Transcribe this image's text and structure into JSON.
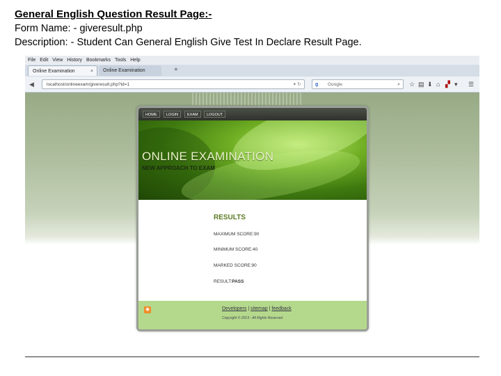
{
  "doc": {
    "title": "General English Question Result Page:-",
    "form_name": "Form Name: - giveresult.php",
    "description": "Description: - Student Can General English Give Test In Declare Result Page."
  },
  "browser": {
    "menu": [
      "File",
      "Edit",
      "View",
      "History",
      "Bookmarks",
      "Tools",
      "Help"
    ],
    "tabs": [
      {
        "label": "Online Examination",
        "close": "×"
      },
      {
        "label": "Online Examination"
      }
    ],
    "new_tab": "+",
    "url": "localhost/onlineexam/giveresult.php?id=1",
    "search_engine": "Google",
    "icons": [
      "back-icon",
      "lock-icon",
      "reload-icon",
      "search-icon",
      "star-icon",
      "bookmarks-icon",
      "download-icon",
      "home-icon",
      "menu-icon"
    ]
  },
  "site": {
    "nav": [
      "HOME",
      "LOGIN",
      "EXAM",
      "LOGOUT"
    ],
    "banner_title": "ONLINE EXAMINATION",
    "banner_subtitle": "NEW APPROACH TO EXAM",
    "results_heading": "RESULTS",
    "max_score": "MAXIMUM SCORE:90",
    "min_score": "MINIMUM SCORE:40",
    "marked_score": "MARKED SCORE:90",
    "result_label": "RESULT:",
    "result_value": "PASS",
    "footer_links": {
      "developers": "Developers",
      "sep1": " | ",
      "sitemap": "sitemap",
      "sep2": " | ",
      "feedback": "feedback"
    },
    "copyright": "Copyright © 2013 - All Rights Reserved"
  },
  "colors": {
    "results_green": "#5a7a22",
    "footer_green": "#b5d98c",
    "nav_dark": "#2e332c"
  }
}
